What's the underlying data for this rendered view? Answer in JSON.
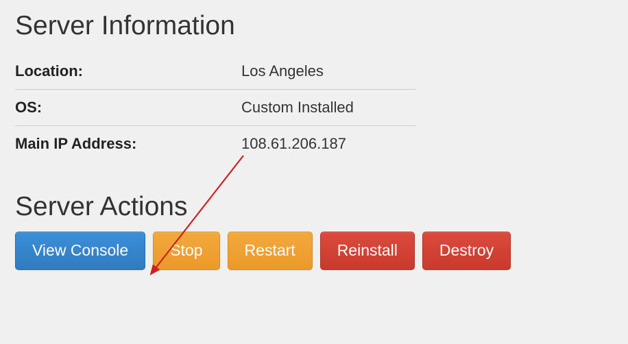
{
  "info": {
    "title": "Server Information",
    "rows": [
      {
        "label": "Location:",
        "value": "Los Angeles"
      },
      {
        "label": "OS:",
        "value": "Custom Installed"
      },
      {
        "label": "Main IP Address:",
        "value": "108.61.206.187"
      }
    ]
  },
  "actions": {
    "title": "Server Actions",
    "buttons": {
      "view_console": "View Console",
      "stop": "Stop",
      "restart": "Restart",
      "reinstall": "Reinstall",
      "destroy": "Destroy"
    }
  },
  "annotation": {
    "arrow_color": "#d22020"
  }
}
